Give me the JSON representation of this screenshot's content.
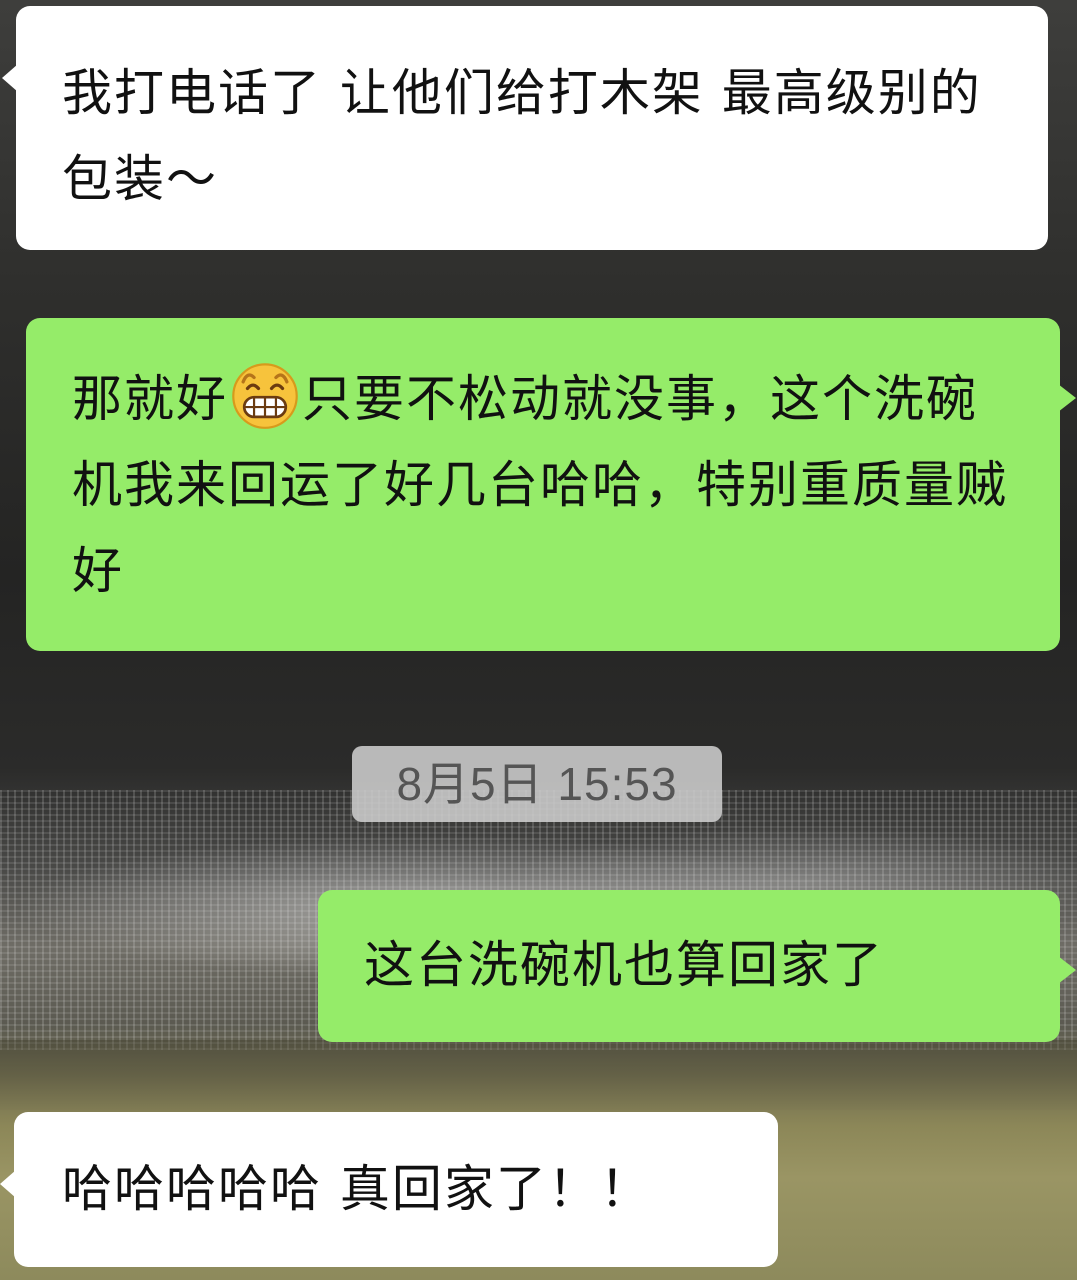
{
  "messages": [
    {
      "side": "left",
      "text": "我打电话了 让他们给打木架 最高级别的包装～"
    },
    {
      "side": "right",
      "text_before": "那就好",
      "emoji": "grinning-face-emoji",
      "text_after": "只要不松动就没事，这个洗碗机我来回运了好几台哈哈，特别重质量贼好"
    },
    {
      "side": "right",
      "text": "这台洗碗机也算回家了"
    },
    {
      "side": "left",
      "text": "哈哈哈哈哈 真回家了！！"
    }
  ],
  "timestamp": "8月5日 15:53",
  "colors": {
    "incoming_bubble": "#ffffff",
    "outgoing_bubble": "#95ec69",
    "timestamp_bg": "#cdcdcd"
  }
}
